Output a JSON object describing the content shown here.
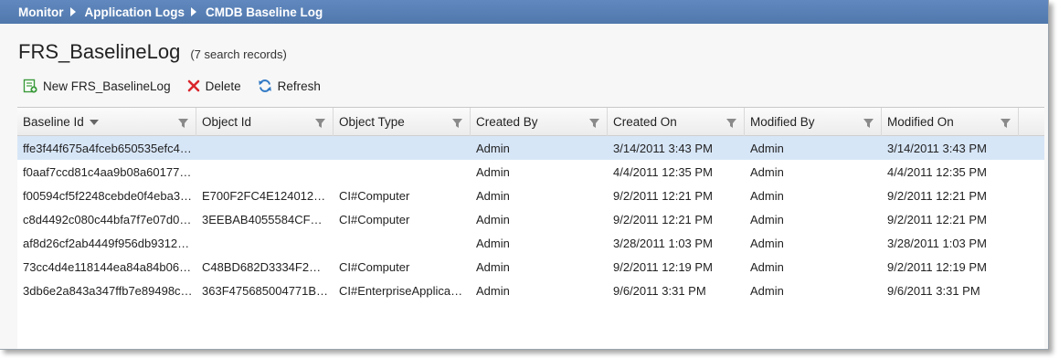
{
  "breadcrumb": {
    "items": [
      "Monitor",
      "Application Logs",
      "CMDB Baseline Log"
    ]
  },
  "page": {
    "title": "FRS_BaselineLog",
    "record_count": "(7 search records)"
  },
  "toolbar": {
    "new_label": "New FRS_BaselineLog",
    "delete_label": "Delete",
    "refresh_label": "Refresh"
  },
  "colors": {
    "breadcrumb_bg": "#5a83b8",
    "selected_row": "#d7e6f7",
    "new_icon": "#3a9a3a",
    "delete_icon": "#d9262c",
    "refresh_icon": "#2f78c4"
  },
  "grid": {
    "columns": [
      "Baseline Id",
      "Object Id",
      "Object Type",
      "Created By",
      "Created On",
      "Modified By",
      "Modified On"
    ],
    "rows": [
      [
        "ffe3f44f675a4fceb650535efc4…",
        "",
        "",
        "Admin",
        "3/14/2011 3:43 PM",
        "Admin",
        "3/14/2011 3:43 PM"
      ],
      [
        "f0aaf7ccd81c4aa9b08a60177…",
        "",
        "",
        "Admin",
        "4/4/2011 12:35 PM",
        "Admin",
        "4/4/2011 12:35 PM"
      ],
      [
        "f00594cf5f2248cebde0f4eba3…",
        "E700F2FC4E124012…",
        "CI#Computer",
        "Admin",
        "9/2/2011 12:21 PM",
        "Admin",
        "9/2/2011 12:21 PM"
      ],
      [
        "c8d4492c080c44bfa7f7e07d0…",
        "3EEBAB4055584CF…",
        "CI#Computer",
        "Admin",
        "9/2/2011 12:21 PM",
        "Admin",
        "9/2/2011 12:21 PM"
      ],
      [
        "af8d26cf2ab4449f956db9312…",
        "",
        "",
        "Admin",
        "3/28/2011 1:03 PM",
        "Admin",
        "3/28/2011 1:03 PM"
      ],
      [
        "73cc4d4e118144ea84a84b06…",
        "C48BD682D3334F2…",
        "CI#Computer",
        "Admin",
        "9/2/2011 12:19 PM",
        "Admin",
        "9/2/2011 12:19 PM"
      ],
      [
        "3db6e2a843a347ffb7e89498c…",
        "363F475685004771B…",
        "CI#EnterpriseApplica…",
        "Admin",
        "9/6/2011 3:31 PM",
        "Admin",
        "9/6/2011 3:31 PM"
      ]
    ]
  }
}
